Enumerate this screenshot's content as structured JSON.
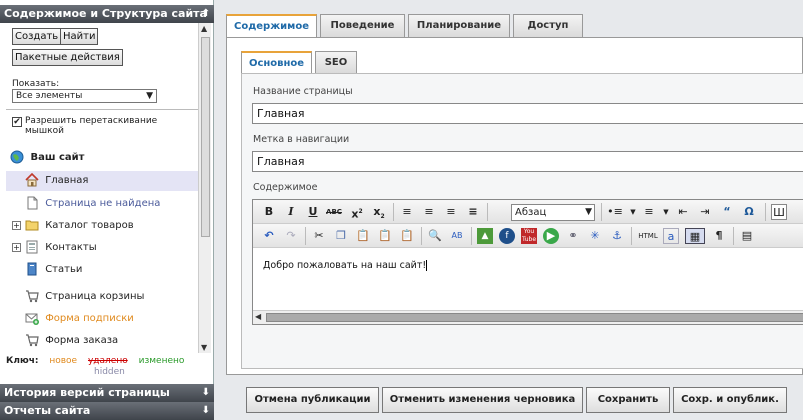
{
  "left_panel": {
    "header": "Содержимое и Структура сайта",
    "buttons": {
      "create": "Создать",
      "find": "Найти",
      "batch": "Пакетные действия"
    },
    "show_label": "Показать:",
    "show_value": "Все элементы",
    "drag_label": "Разрешить перетаскивание мышкой",
    "drag_checked": true,
    "tree": [
      {
        "label": "Ваш сайт",
        "icon": "globe-icon"
      },
      {
        "label": "Главная",
        "icon": "home-icon",
        "selected": true
      },
      {
        "label": "Страница не найдена",
        "icon": "page-icon"
      },
      {
        "label": "Каталог товаров",
        "icon": "folder-icon",
        "expandable": true
      },
      {
        "label": "Контакты",
        "icon": "contacts-icon",
        "expandable": true
      },
      {
        "label": "Статьи",
        "icon": "articles-icon"
      },
      {
        "label": "Страница корзины",
        "icon": "cart-icon"
      },
      {
        "label": "Форма подписки",
        "icon": "mail-add-icon",
        "status": "new"
      },
      {
        "label": "Форма заказа",
        "icon": "cart-icon"
      }
    ],
    "legend": {
      "key": "Ключ:",
      "new": "новое",
      "deleted": "удалено",
      "changed": "изменено",
      "hidden": "hidden"
    },
    "history_header": "История версий страницы",
    "reports_header": "Отчеты сайта"
  },
  "main_tabs": [
    {
      "label": "Содержимое",
      "active": true
    },
    {
      "label": "Поведение"
    },
    {
      "label": "Планирование"
    },
    {
      "label": "Доступ"
    }
  ],
  "sub_tabs": [
    {
      "label": "Основное",
      "active": true
    },
    {
      "label": "SEO"
    }
  ],
  "fields": {
    "page_name_label": "Название страницы",
    "page_name_value": "Главная",
    "nav_label": "Метка в навигации",
    "nav_value": "Главная",
    "content_label": "Содержимое"
  },
  "editor": {
    "format_value": "Абзац",
    "content": "Добро пожаловать на наш сайт!"
  },
  "actions": {
    "unpublish": "Отмена публикации",
    "discard_draft": "Отменить изменения черновика",
    "save": "Сохранить",
    "save_publish": "Сохр. и опублик."
  },
  "colors": {
    "accent": "#1f6aa8",
    "tab_highlight": "#e8a33a",
    "status_new": "#e08a1e",
    "status_deleted": "#cc0000",
    "status_changed": "#2a9a2a",
    "selected_row": "#e4e4f5"
  }
}
